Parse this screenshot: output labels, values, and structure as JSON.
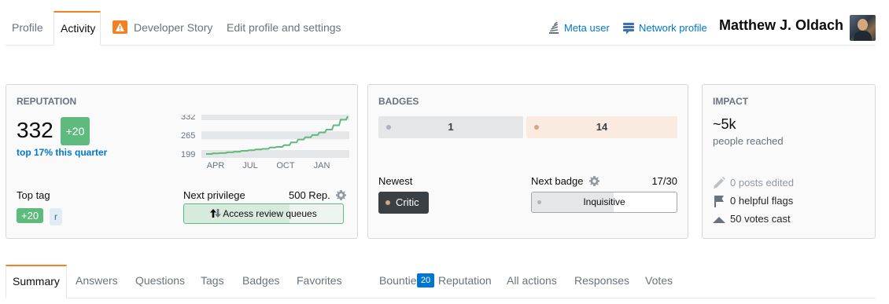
{
  "top_tabs": {
    "profile": "Profile",
    "activity": "Activity",
    "developer_story": "Developer Story",
    "edit": "Edit profile and settings"
  },
  "header": {
    "meta_user": "Meta user",
    "network_profile": "Network profile",
    "user_name": "Matthew J. Oldach"
  },
  "reputation": {
    "title": "REPUTATION",
    "value": "332",
    "delta": "+20",
    "rank": "top 17% this quarter",
    "top_tag_label": "Top tag",
    "top_tag_score": "+20",
    "top_tag_name": "r",
    "next_privilege_label": "Next privilege",
    "next_privilege_rep": "500 Rep.",
    "next_privilege_name": "Access review queues",
    "next_privilege_progress": 0.664
  },
  "chart_data": {
    "type": "line",
    "title": "",
    "x_ticks": [
      "APR",
      "JUL",
      "OCT",
      "JAN"
    ],
    "y_ticks": [
      332,
      265,
      199
    ],
    "ylim": [
      199,
      332
    ],
    "series": [
      {
        "values": [
          199,
          201,
          202,
          205,
          207,
          210,
          212,
          215,
          217,
          222,
          224,
          230,
          240,
          250,
          258,
          266,
          275,
          285,
          300,
          320,
          332
        ]
      }
    ],
    "grid": true,
    "color": "#5eba7d"
  },
  "badges": {
    "title": "BADGES",
    "gold_count": "1",
    "bronze_count": "14",
    "newest_label": "Newest",
    "newest_name": "Critic",
    "next_badge_label": "Next badge",
    "next_badge_progress_text": "17/30",
    "next_badge_name": "Inquisitive",
    "next_badge_progress": 0.567,
    "colors": {
      "gold_bg": "#e4e6e8",
      "bronze_bg": "#faeadf"
    }
  },
  "impact": {
    "title": "IMPACT",
    "reached": "~5k",
    "reached_label": "people reached",
    "posts_edited": "0 posts edited",
    "helpful_flags": "0 helpful flags",
    "votes_cast": "50 votes cast"
  },
  "bottom_tabs": {
    "summary": "Summary",
    "answers": "Answers",
    "questions": "Questions",
    "tags": "Tags",
    "badges": "Badges",
    "favorites": "Favorites",
    "bounties": "Bounties",
    "reputation_count": "20",
    "reputation": "Reputation",
    "all_actions": "All actions",
    "responses": "Responses",
    "votes": "Votes"
  }
}
